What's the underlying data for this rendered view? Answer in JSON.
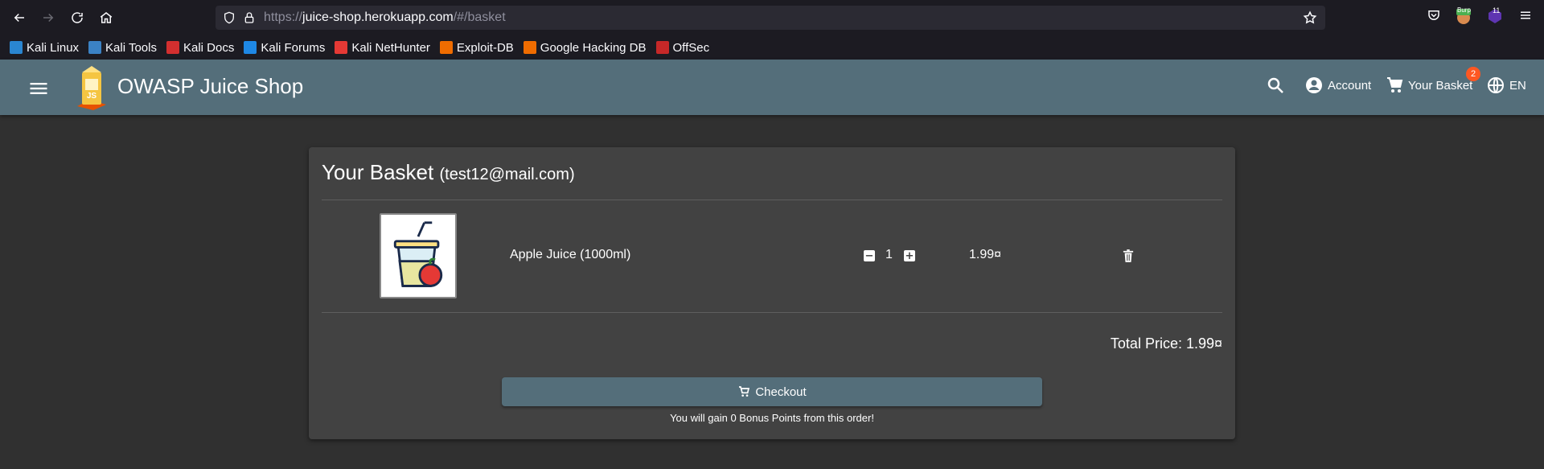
{
  "browser": {
    "url_prefix": "https://",
    "url_host": "juice-shop.herokuapp.com",
    "url_path": "/#/basket",
    "burp_label": "Burp",
    "ext_count": "11"
  },
  "bookmarks": [
    {
      "label": "Kali Linux",
      "icon": "kali-dragon-icon",
      "color": "#2a86d1"
    },
    {
      "label": "Kali Tools",
      "icon": "kali-tools-icon",
      "color": "#3b82c4"
    },
    {
      "label": "Kali Docs",
      "icon": "kali-docs-icon",
      "color": "#d32f2f"
    },
    {
      "label": "Kali Forums",
      "icon": "kali-forums-icon",
      "color": "#1e88e5"
    },
    {
      "label": "Kali NetHunter",
      "icon": "nethunter-icon",
      "color": "#e53935"
    },
    {
      "label": "Exploit-DB",
      "icon": "exploit-db-icon",
      "color": "#ef6c00"
    },
    {
      "label": "Google Hacking DB",
      "icon": "ghdb-icon",
      "color": "#ef6c00"
    },
    {
      "label": "OffSec",
      "icon": "offsec-icon",
      "color": "#c62828"
    }
  ],
  "app": {
    "title": "OWASP Juice Shop",
    "account_label": "Account",
    "basket_label": "Your Basket",
    "basket_count": "2",
    "language": "EN"
  },
  "basket": {
    "title": "Your Basket",
    "email": "(test12@mail.com)",
    "items": [
      {
        "name": "Apple Juice (1000ml)",
        "quantity": "1",
        "price": "1.99¤"
      }
    ],
    "total": "Total Price: 1.99¤",
    "checkout_label": "Checkout",
    "bonus_text": "You will gain 0 Bonus Points from this order!"
  },
  "colors": {
    "toolbar": "#546e7a",
    "card": "#424242",
    "background": "#303030",
    "badge": "#ff5722"
  }
}
